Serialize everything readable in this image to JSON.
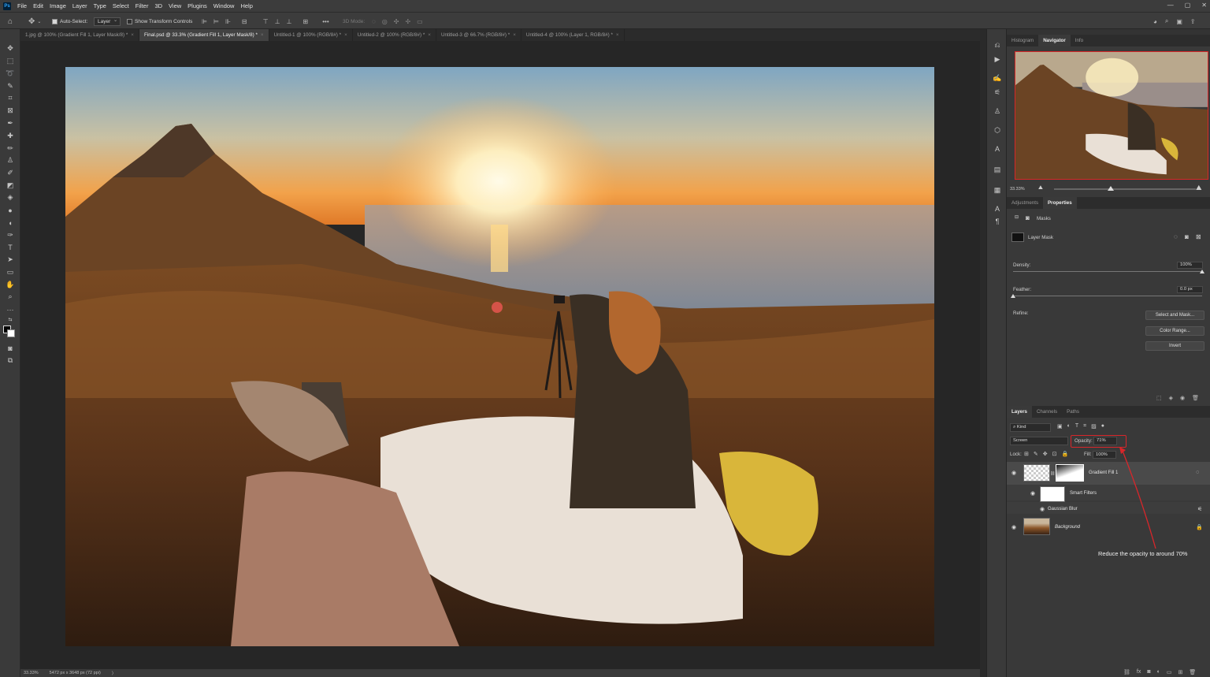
{
  "app": {
    "logo": "Ps"
  },
  "menu": [
    "File",
    "Edit",
    "Image",
    "Layer",
    "Type",
    "Select",
    "Filter",
    "3D",
    "View",
    "Plugins",
    "Window",
    "Help"
  ],
  "window_controls": [
    "—",
    "▢",
    "✕"
  ],
  "options": {
    "auto_select_label": "Auto-Select:",
    "auto_select_value": "Layer",
    "show_transform_label": "Show Transform Controls",
    "mode_3d_label": "3D Mode:"
  },
  "doc_tabs": [
    {
      "label": "1.jpg @ 100% (Gradient Fill 1, Layer Mask/8) *",
      "close": "×"
    },
    {
      "label": "Final.psd @ 33.3% (Gradient Fill 1, Layer Mask/8) *",
      "close": "×"
    },
    {
      "label": "Untitled-1 @ 100% (RGB/8#) *",
      "close": "×"
    },
    {
      "label": "Untitled-2 @ 100% (RGB/8#) *",
      "close": "×"
    },
    {
      "label": "Untitled-3 @ 66.7% (RGB/8#) *",
      "close": "×"
    },
    {
      "label": "Untitled-4 @ 100% (Layer 1, RGB/8#) *",
      "close": "×"
    }
  ],
  "status": {
    "zoom": "33.33%",
    "dimensions": "5472 px x 3648 px (72 ppi)",
    "arrow": "〉"
  },
  "navigator": {
    "tabs": [
      "Histogram",
      "Navigator",
      "Info"
    ],
    "zoom": "33.33%"
  },
  "properties": {
    "tabs": [
      "Adjustments",
      "Properties"
    ],
    "section": "Masks",
    "mask_name": "Layer Mask",
    "density_label": "Density:",
    "density_value": "100%",
    "density_level": 1.0,
    "feather_label": "Feather:",
    "feather_value": "0.0 px",
    "feather_level": 0.0,
    "refine_label": "Refine:",
    "buttons": [
      "Select and Mask...",
      "Color Range...",
      "Invert"
    ]
  },
  "layers": {
    "tabs": [
      "Layers",
      "Channels",
      "Paths"
    ],
    "kind_label": "Kind",
    "blend_mode": "Screen",
    "opacity_label": "Opacity:",
    "opacity_value": "71%",
    "lock_label": "Lock:",
    "fill_label": "Fill:",
    "fill_value": "100%",
    "items": [
      {
        "name": "Gradient Fill 1"
      },
      {
        "name": "Smart Filters"
      },
      {
        "name": "Gaussian Blur"
      },
      {
        "name": "Background"
      }
    ]
  },
  "annotation": {
    "text": "Reduce the opacity to around 70%",
    "color": "#d8262a"
  }
}
